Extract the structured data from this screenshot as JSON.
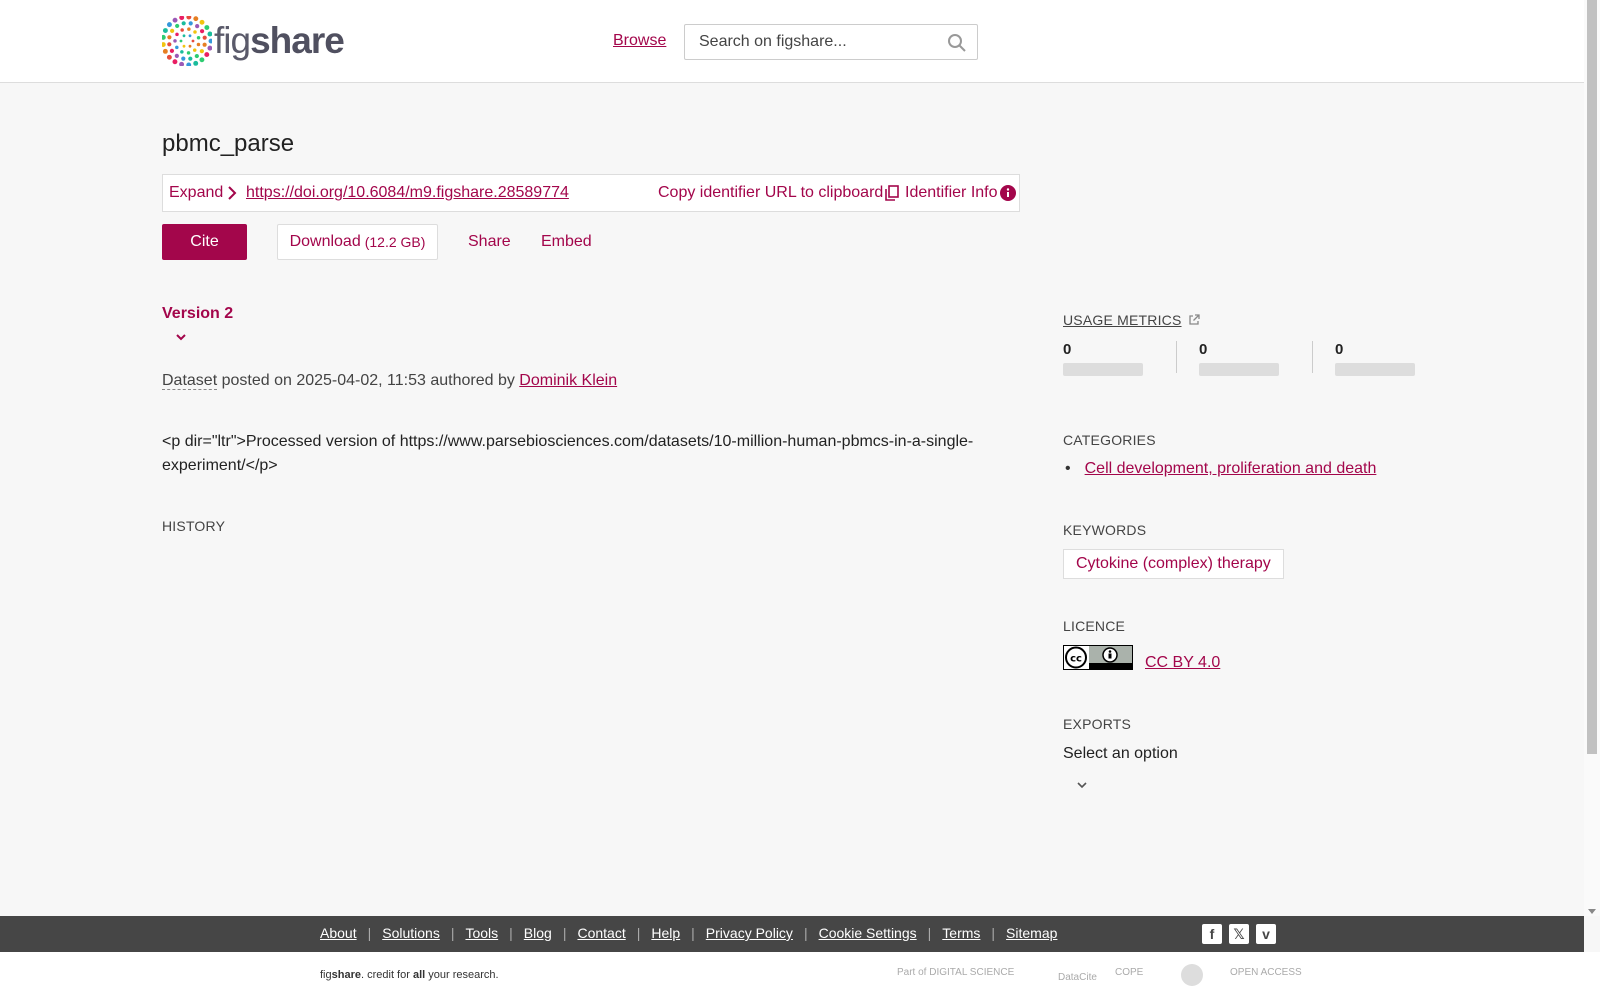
{
  "header": {
    "logo_text_fig": "fig",
    "logo_text_share": "share",
    "browse_label": "Browse",
    "search_placeholder": "Search on figshare..."
  },
  "item": {
    "title": "pbmc_parse",
    "expand_label": "Expand",
    "doi_url": "https://doi.org/10.6084/m9.figshare.28589774",
    "copy_label": "Copy identifier URL to clipboard",
    "identifier_info_label": "Identifier Info",
    "cite_label": "Cite",
    "download_label": "Download",
    "download_size": "(12.2 GB)",
    "share_label": "Share",
    "embed_label": "Embed",
    "version_label": "Version 2",
    "item_type": "Dataset",
    "posted_text": " posted on 2025-04-02, 11:53 authored by ",
    "author": "Dominik Klein",
    "description": "<p dir=\"ltr\">Processed version of https://www.parsebiosciences.com/datasets/10-million-human-pbmcs-in-a-single-experiment/</p>",
    "history_label": "HISTORY"
  },
  "sidebar": {
    "usage_metrics_label": "USAGE METRICS",
    "metrics": [
      "0",
      "0",
      "0"
    ],
    "categories_label": "CATEGORIES",
    "categories": [
      "Cell development, proliferation and death"
    ],
    "keywords_label": "KEYWORDS",
    "keywords": [
      "Cytokine (complex) therapy"
    ],
    "licence_label": "LICENCE",
    "licence_name": "CC BY 4.0",
    "exports_label": "EXPORTS",
    "exports_select": "Select an option"
  },
  "footer": {
    "links": [
      "About",
      "Solutions",
      "Tools",
      "Blog",
      "Contact",
      "Help",
      "Privacy Policy",
      "Cookie Settings",
      "Terms",
      "Sitemap"
    ],
    "tagline_fig": "fig",
    "tagline_share": "share",
    "tagline_rest_1": ". credit for ",
    "tagline_all": "all",
    "tagline_rest_2": " your research.",
    "partners": [
      "Part of DIGITAL SCIENCE",
      "DataCite",
      "COPE",
      "",
      "OPEN ACCESS"
    ]
  },
  "colors": {
    "accent": "#a3064b",
    "footer_bg": "#464646",
    "page_bg": "#f7f7f7"
  },
  "icons": [
    "figshare-logo-icon",
    "search-icon",
    "chevron-right-icon",
    "copy-icon",
    "info-icon",
    "chevron-down-icon",
    "external-link-icon",
    "cc-by-icon",
    "facebook-icon",
    "x-icon",
    "vimeo-icon"
  ]
}
